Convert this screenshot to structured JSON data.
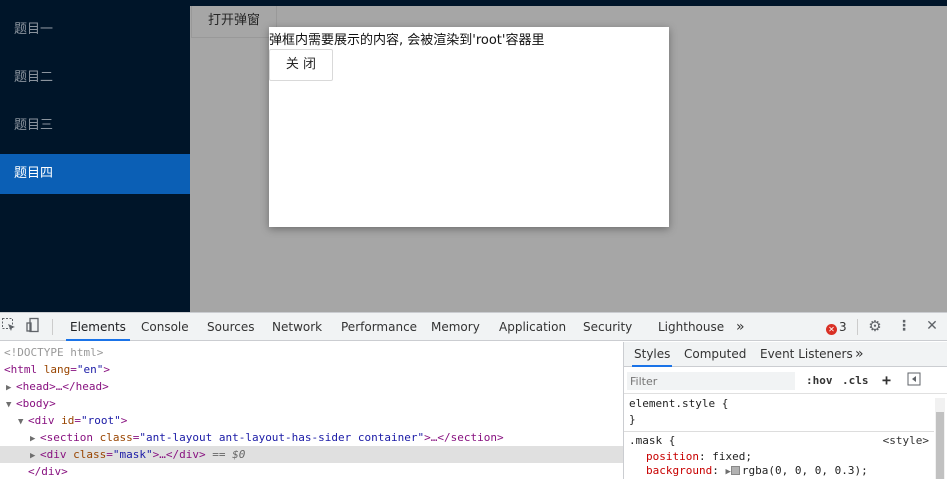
{
  "app": {
    "sider_items": [
      {
        "label": "题目一",
        "selected": false
      },
      {
        "label": "题目二",
        "selected": false
      },
      {
        "label": "题目三",
        "selected": false
      },
      {
        "label": "题目四",
        "selected": true
      }
    ],
    "open_button": "打开弹窗",
    "modal": {
      "text": "弹框内需要展示的内容, 会被渲染到'root'容器里",
      "close_button": "关 闭"
    },
    "colors": {
      "mask": "#a6a6a6",
      "sider": "#001529",
      "selected": "#0b5fb5"
    }
  },
  "devtools": {
    "tabs": [
      "Elements",
      "Console",
      "Sources",
      "Network",
      "Performance",
      "Memory",
      "Application",
      "Security",
      "Lighthouse"
    ],
    "active_tab": "Elements",
    "more": "»",
    "error_count": "3",
    "icons": [
      "inspect-icon",
      "device-toolbar-icon",
      "settings-icon",
      "more-vertical-icon",
      "close-icon"
    ],
    "dom": {
      "doctype": "<!DOCTYPE html>",
      "html_open": {
        "tag": "<html",
        "attr": "lang",
        "value": "\"en\"",
        "end": ">"
      },
      "head": "<head>…</head>",
      "body": "<body>",
      "root": {
        "tag": "<div",
        "attr": "id",
        "value": "\"root\"",
        "end": ">"
      },
      "section": {
        "tag": "<section",
        "attr": "class",
        "value": "\"ant-layout ant-layout-has-sider container\"",
        "end": ">…</section>"
      },
      "mask": {
        "tag": "<div",
        "attr": "class",
        "value": "\"mask\"",
        "end": ">…</div>",
        "suffix": " == $0"
      },
      "div_close": "</div>"
    },
    "styles": {
      "tabs": [
        "Styles",
        "Computed",
        "Event Listeners"
      ],
      "active_tab": "Styles",
      "more": "»",
      "filter_placeholder": "Filter",
      "hov": ":hov",
      "cls": ".cls",
      "plus": "+",
      "element_style": "element.style {",
      "close_brace": "}",
      "rule_selector": ".mask {",
      "rule_source": "<style>",
      "decl1": {
        "prop": "position",
        "value": "fixed;"
      },
      "decl2": {
        "prop": "background",
        "value": "rgba(0, 0, 0, 0.3);"
      }
    }
  }
}
